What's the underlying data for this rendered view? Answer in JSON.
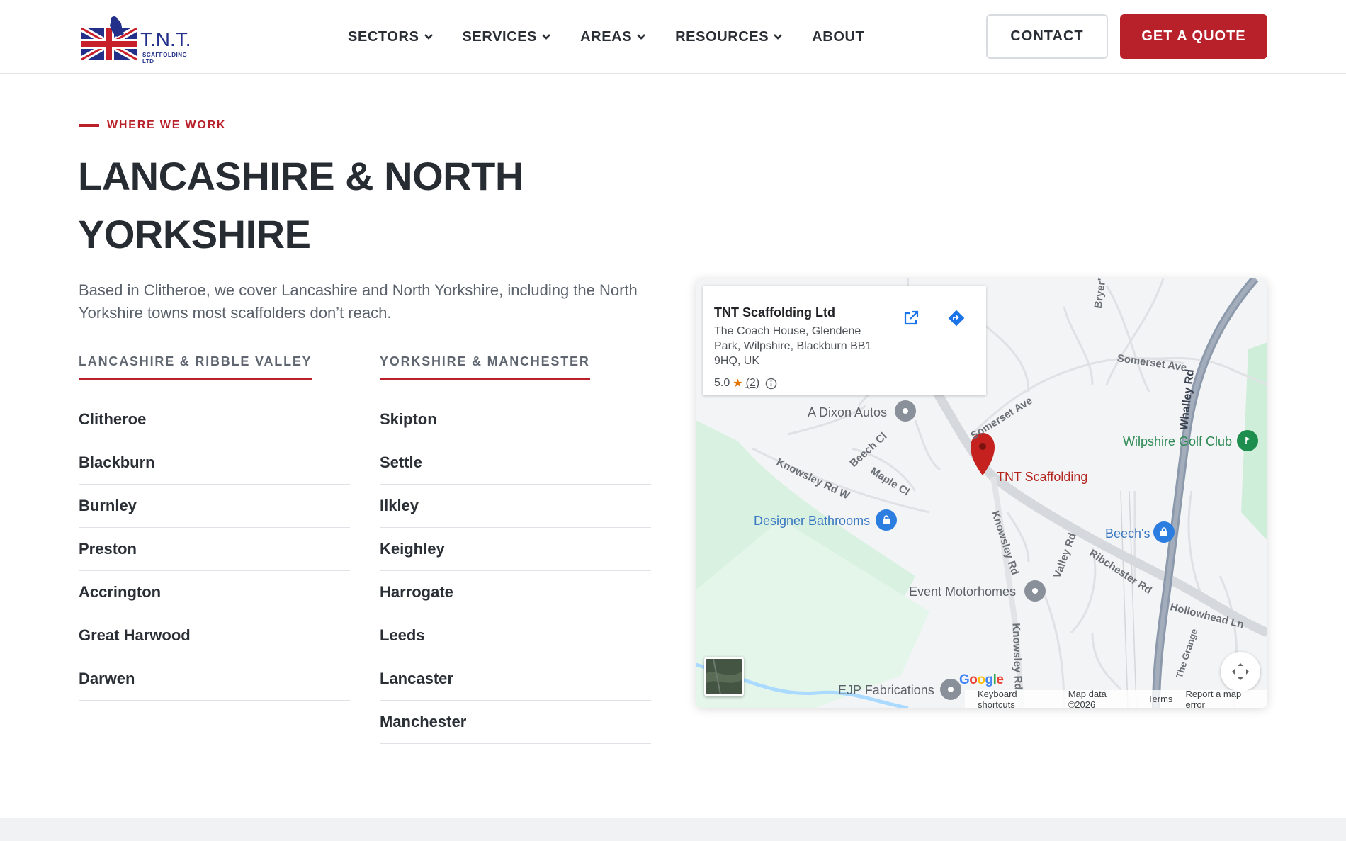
{
  "brand": {
    "name": "T.N.T.",
    "subtitle": "SCAFFOLDING LTD"
  },
  "nav": {
    "items": [
      {
        "label": "SECTORS",
        "dropdown": true
      },
      {
        "label": "SERVICES",
        "dropdown": true
      },
      {
        "label": "AREAS",
        "dropdown": true
      },
      {
        "label": "RESOURCES",
        "dropdown": true
      },
      {
        "label": "ABOUT",
        "dropdown": false
      }
    ],
    "contact_label": "CONTACT",
    "quote_label": "GET A QUOTE"
  },
  "colors": {
    "accent": "#b8202a",
    "text_dark": "#272c33",
    "text_muted": "#5a616b",
    "navy": "#22308a"
  },
  "section": {
    "eyebrow": "WHERE WE WORK",
    "title": "LANCASHIRE & NORTH YORKSHIRE",
    "intro": "Based in Clitheroe, we cover Lancashire and North Yorkshire, including the North Yorkshire towns most scaffolders don’t reach."
  },
  "areas": {
    "lancashire": {
      "heading": "LANCASHIRE & RIBBLE VALLEY",
      "towns": [
        "Clitheroe",
        "Blackburn",
        "Burnley",
        "Preston",
        "Accrington",
        "Great Harwood",
        "Darwen"
      ]
    },
    "yorkshire": {
      "heading": "YORKSHIRE & MANCHESTER",
      "towns": [
        "Skipton",
        "Settle",
        "Ilkley",
        "Keighley",
        "Harrogate",
        "Leeds",
        "Lancaster",
        "Manchester"
      ]
    }
  },
  "map": {
    "card": {
      "name": "TNT Scaffolding Ltd",
      "address": "The Coach House, Glendene Park, Wilpshire, Blackburn BB1 9HQ, UK",
      "rating": "5.0",
      "reviews": "(2)"
    },
    "marker_label": "TNT Scaffolding",
    "places": {
      "dixon": "A Dixon Autos",
      "bathrooms": "Designer Bathrooms",
      "golf": "Wilpshire Golf Club",
      "beechs": "Beech's",
      "motorhomes": "Event Motorhomes",
      "ejp": "EJP Fabrications"
    },
    "roads": {
      "brycers": "Bryer's Croft",
      "somerset_ave_top": "Somerset Ave",
      "somerset_ave": "Somerset Ave",
      "whalley": "Whalley Rd",
      "beech_cl": "Beech Cl",
      "maple_cl": "Maple Cl",
      "knowsley_w": "Knowsley Rd W",
      "knowsley_rd": "Knowsley Rd",
      "knowsley_rd2": "Knowsley Rd",
      "valley_rd": "Valley Rd",
      "ribchester": "Ribchester Rd",
      "hollowhead": "Hollowhead Ln",
      "the_grange": "The Grange"
    },
    "footer": {
      "google": "Google",
      "shortcuts": "Keyboard shortcuts",
      "data": "Map data ©2026",
      "terms": "Terms",
      "report": "Report a map error"
    }
  }
}
